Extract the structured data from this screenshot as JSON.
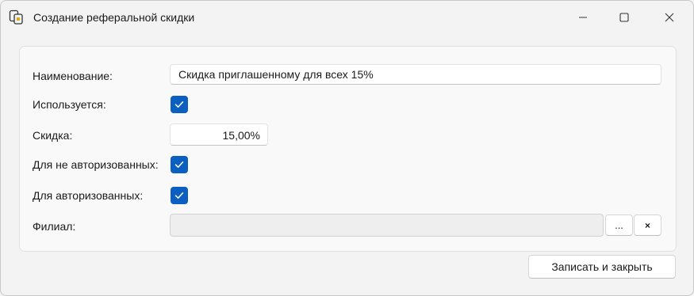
{
  "window": {
    "title": "Создание реферальной скидки",
    "icon": "app-copy-icon"
  },
  "form": {
    "name_label": "Наименование:",
    "name_value": "Скидка приглашенному для всех 15%",
    "used_label": "Используется:",
    "used_checked": true,
    "discount_label": "Скидка:",
    "discount_value": "15,00%",
    "unauthorized_label": "Для не авторизованных:",
    "unauthorized_checked": true,
    "authorized_label": "Для авторизованных:",
    "authorized_checked": true,
    "branch_label": "Филиал:",
    "branch_value": "",
    "branch_select_label": "...",
    "branch_clear_label": "×"
  },
  "footer": {
    "save_close_label": "Записать и закрыть"
  },
  "colors": {
    "accent": "#0a5fc0",
    "background": "#f3f3f3"
  }
}
